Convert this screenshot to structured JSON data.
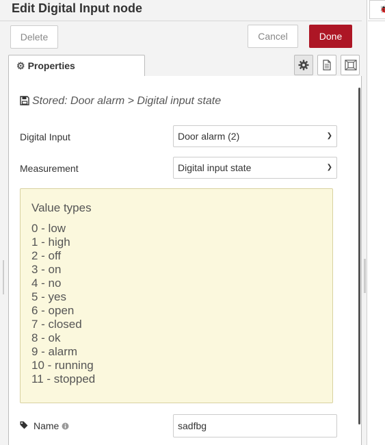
{
  "tray": {
    "title": "Edit Digital Input node",
    "delete_label": "Delete",
    "cancel_label": "Cancel",
    "done_label": "Done"
  },
  "tabs": {
    "properties_label": "Properties"
  },
  "tab_icons": [
    "gear-icon",
    "description-icon",
    "appearance-icon"
  ],
  "form": {
    "stored_text": "Stored: Door alarm > Digital input state",
    "digital_input_label": "Digital Input",
    "digital_input_value": "Door alarm (2)",
    "measurement_label": "Measurement",
    "measurement_value": "Digital input state",
    "name_label": "Name",
    "name_value": "sadfbg"
  },
  "value_types": {
    "title": "Value types",
    "items": [
      "0 - low",
      "1 - high",
      "2 - off",
      "3 - on",
      "4 - no",
      "5 - yes",
      "6 - open",
      "7 - closed",
      "8 - ok",
      "9 - alarm",
      "10 - running",
      "11 - stopped"
    ]
  },
  "colors": {
    "done_button": "#ad1625",
    "value_box_bg": "#fbf8dd"
  }
}
